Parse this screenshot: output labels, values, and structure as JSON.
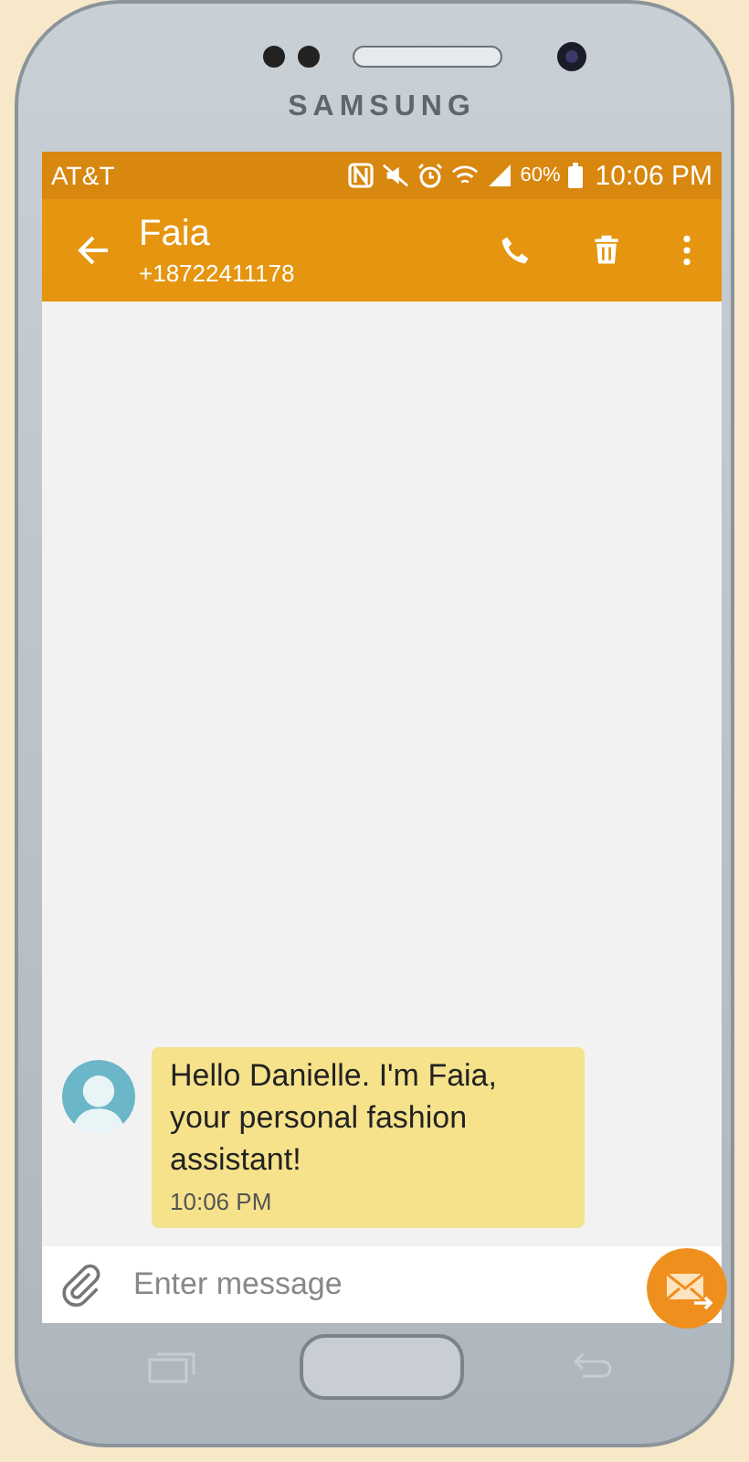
{
  "device": {
    "brand": "SAMSUNG"
  },
  "status_bar": {
    "carrier": "AT&T",
    "battery": "60%",
    "time": "10:06 PM"
  },
  "header": {
    "title": "Faia",
    "subtitle": "+18722411178"
  },
  "messages": [
    {
      "kind": "incoming",
      "text": "Hello Danielle. I'm Faia, your personal fashion assistant!",
      "time": "10:06 PM"
    }
  ],
  "composer": {
    "placeholder": "Enter message"
  }
}
